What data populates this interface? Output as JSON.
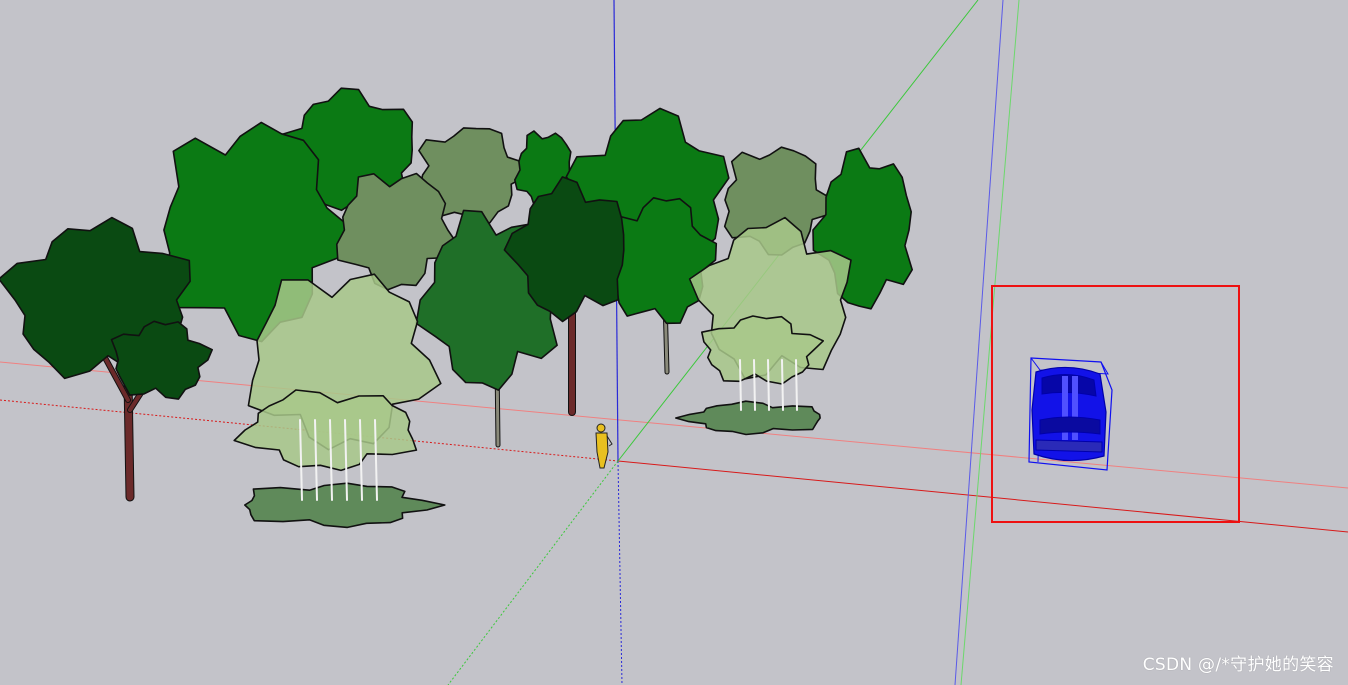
{
  "canvas": {
    "background": "#c3c3c9",
    "axes": {
      "red": "#e02020",
      "green": "#3cc83c",
      "blue": "#2a2ad8"
    }
  },
  "scene": {
    "tree_colors": {
      "dark": "#0a4a12",
      "green": "#0b7a14",
      "mid": "#1f6f28",
      "sage": "#6f8f5f",
      "light": "#a8c88a",
      "trunk": "#6b2a2a",
      "outline": "#111111"
    },
    "selection": {
      "box_color": "#ee1111",
      "car_color": "#1010f0",
      "car_outline": "#0000cc"
    },
    "person_color": "#e8c020"
  },
  "watermark": {
    "text": "CSDN @/*守护她的笑容"
  }
}
